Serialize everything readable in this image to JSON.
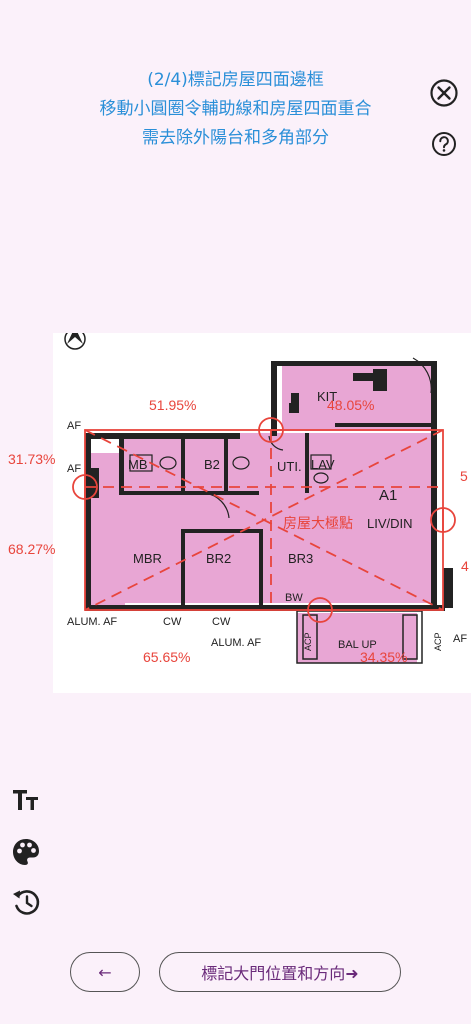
{
  "instructions": {
    "line1": "(2/4)標記房屋四面邊框",
    "line2": "移動小圓圈令輔助線和房屋四面重合",
    "line3": "需去除外陽台和多角部分"
  },
  "plan": {
    "center_label": "房屋大極點",
    "rooms": {
      "kit": "KIT",
      "mb": "MB",
      "b2": "B2",
      "uti": "UTI.",
      "lav": "LAV",
      "a1": "A1",
      "livdin": "LIV/DIN",
      "mbr": "MBR",
      "br2": "BR2",
      "br3": "BR3",
      "bw": "BW",
      "af1": "AF",
      "af2": "AF",
      "alum1": "ALUM. AF",
      "alum2": "ALUM. AF",
      "cw1": "CW",
      "cw2": "CW",
      "bal": "BAL UP",
      "acp1": "ACP",
      "acp2": "ACP",
      "af3": "AF"
    },
    "percentages": {
      "top_left": "51.95%",
      "top_right": "48.05%",
      "left_top": "31.73%",
      "left_bottom": "68.27%",
      "bottom_left": "65.65%",
      "bottom_right": "34.35%",
      "right_top": "5",
      "right_bottom": "4"
    }
  },
  "buttons": {
    "back": "←",
    "next": "標記大門位置和方向➜"
  },
  "icons": [
    "close-icon",
    "help-icon",
    "text-size-icon",
    "palette-icon",
    "reset-icon"
  ],
  "colors": {
    "instruction_text": "#2a8fd8",
    "accent_red": "#e8453c",
    "room_pink": "#e8a6d4",
    "button_text": "#6a2a7a",
    "background": "#fbf1fa"
  }
}
